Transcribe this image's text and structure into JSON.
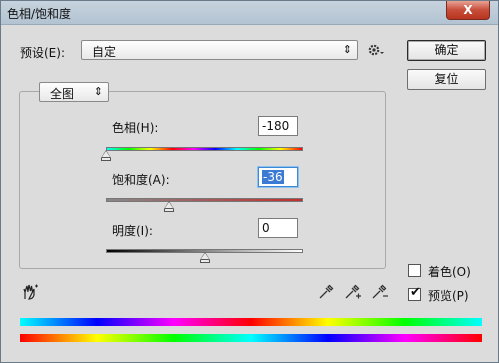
{
  "window": {
    "title": "色相/饱和度",
    "close_label": "X"
  },
  "preset": {
    "label": "预设(E):",
    "value": "自定"
  },
  "buttons": {
    "ok": "确定",
    "reset": "复位"
  },
  "channel": {
    "value": "全图"
  },
  "hue": {
    "label": "色相(H):",
    "value": "-180",
    "slider_fraction": 0.0
  },
  "saturation": {
    "label": "饱和度(A):",
    "value": "-36",
    "slider_fraction": 0.32
  },
  "lightness": {
    "label": "明度(I):",
    "value": "0",
    "slider_fraction": 0.5
  },
  "options": {
    "colorize": {
      "label": "着色(O)",
      "checked": false
    },
    "preview": {
      "label": "预览(P)",
      "checked": true
    }
  },
  "icons": {
    "gear": "gear-icon",
    "hand": "hand-adjust-icon",
    "eyedropper": "eyedropper-icon",
    "eyedropper_plus": "eyedropper-plus-icon",
    "eyedropper_minus": "eyedropper-minus-icon"
  },
  "colors": {
    "title_bg": "#b9c8d6",
    "dialog_bg": "#dcdcdc",
    "close_red": "#c74d3a",
    "focus_blue": "#3b7bd4",
    "saturation_track": "#c43030"
  }
}
